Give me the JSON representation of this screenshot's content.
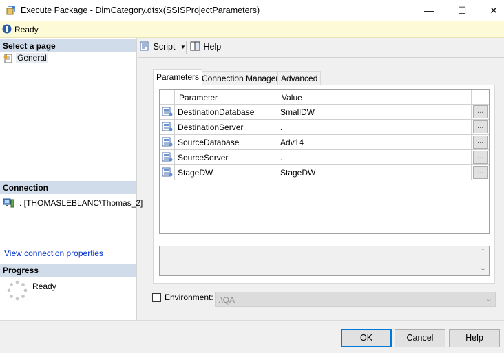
{
  "window": {
    "title": "Execute Package - DimCategory.dtsx(SSISProjectParameters)",
    "minimize": "—",
    "maximize": "☐",
    "close": "✕"
  },
  "status": {
    "text": "Ready",
    "icon": "info-icon"
  },
  "left": {
    "select_page_header": "Select a page",
    "pages": [
      {
        "label": "General",
        "icon": "general-page-icon"
      }
    ],
    "connection_header": "Connection",
    "connection_text": ". [THOMASLEBLANC\\Thomas_2]",
    "view_connection_link": "View connection properties",
    "progress_header": "Progress",
    "progress_text": "Ready"
  },
  "toolbar": {
    "script_label": "Script",
    "help_label": "Help"
  },
  "tabs": [
    {
      "label": "Parameters",
      "active": true
    },
    {
      "label": "Connection Managers",
      "active": false
    },
    {
      "label": "Advanced",
      "active": false
    }
  ],
  "grid": {
    "columns": [
      "Parameter",
      "Value"
    ],
    "rows": [
      {
        "parameter": "DestinationDatabase",
        "value": "SmallDW",
        "button": "..."
      },
      {
        "parameter": "DestinationServer",
        "value": ".",
        "button": "..."
      },
      {
        "parameter": "SourceDatabase",
        "value": "Adv14",
        "button": "..."
      },
      {
        "parameter": "SourceServer",
        "value": ".",
        "button": "..."
      },
      {
        "parameter": "StageDW",
        "value": "StageDW",
        "button": "..."
      }
    ]
  },
  "environment": {
    "label": "Environment:",
    "value": ".\\QA",
    "checked": false
  },
  "buttons": {
    "ok": "OK",
    "cancel": "Cancel",
    "help": "Help"
  },
  "colors": {
    "status_bg": "#fdfbd7",
    "section_header_bg": "#d1dcea",
    "link": "#0033cc",
    "default_button_border": "#0078d7"
  }
}
